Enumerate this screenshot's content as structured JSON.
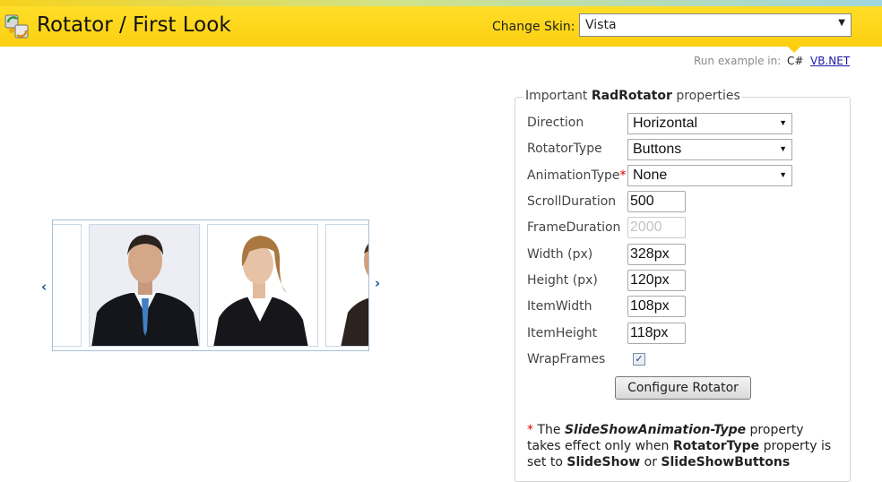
{
  "header": {
    "title": "Rotator / First Look",
    "skin_label": "Change Skin:",
    "skin_value": "Vista"
  },
  "run_example": {
    "label": "Run example in:",
    "languages": [
      "C#",
      "VB.NET"
    ]
  },
  "panel": {
    "legend_pre": "Important ",
    "legend_bold": "RadRotator",
    "legend_post": " properties",
    "direction_label": "Direction",
    "direction_value": "Horizontal",
    "rotatortype_label": "RotatorType",
    "rotatortype_value": "Buttons",
    "animationtype_label": "AnimationType",
    "animationtype_required": "*",
    "animationtype_value": "None",
    "scrollduration_label": "ScrollDuration",
    "scrollduration_value": "500",
    "frameduration_label": "FrameDuration",
    "frameduration_value": "2000",
    "width_label": "Width (px)",
    "width_value": "328px",
    "height_label": "Height (px)",
    "height_value": "120px",
    "itemwidth_label": "ItemWidth",
    "itemwidth_value": "108px",
    "itemheight_label": "ItemHeight",
    "itemheight_value": "118px",
    "wrapframes_label": "WrapFrames",
    "wrapframes_checked": true,
    "configure_button": "Configure Rotator"
  },
  "note": {
    "star": "* ",
    "p1": "The ",
    "b1": "SlideShowAnimation-Type",
    "p2": " property takes effect only when ",
    "b2": "RotatorType",
    "p3": " property is set to ",
    "b3": "SlideShow",
    "p4": " or ",
    "b4": "SlideShowButtons"
  },
  "colors": {
    "header_bg": "#fbcf10",
    "link": "#1a1aa8",
    "required": "#dd0000",
    "arrow": "#1b4f9c"
  }
}
